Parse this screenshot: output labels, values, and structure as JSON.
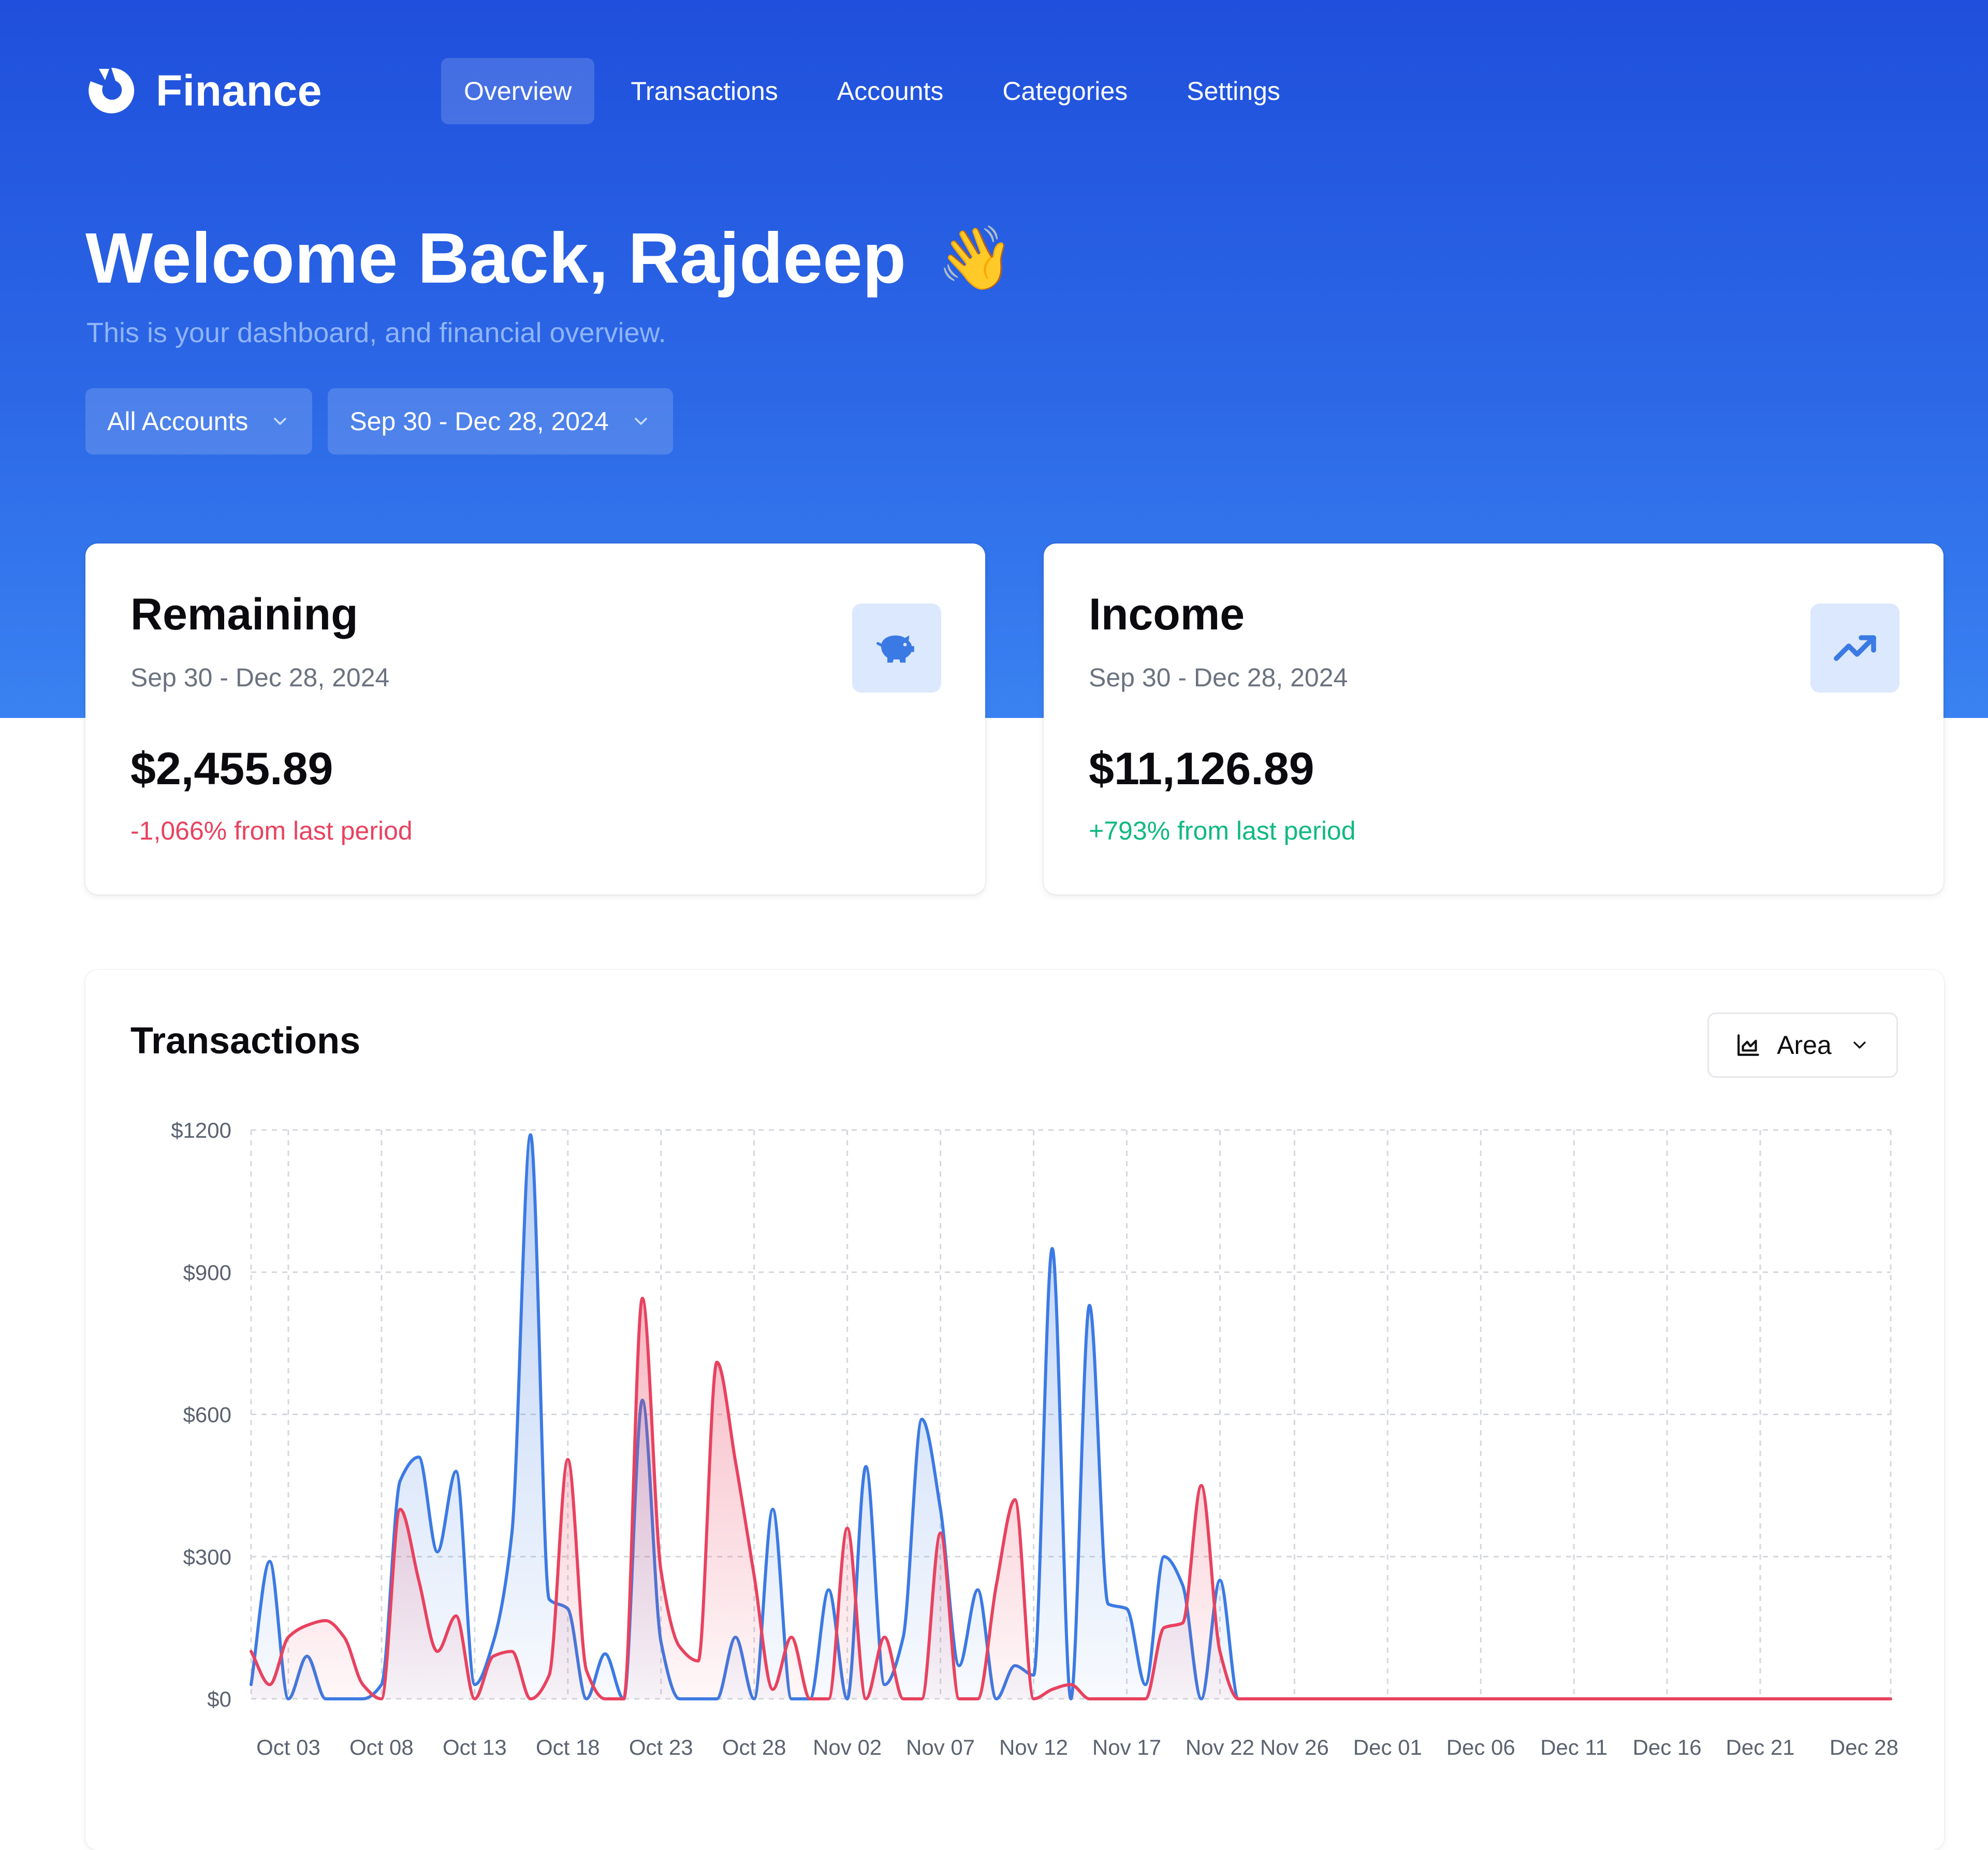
{
  "app": {
    "name": "Finance",
    "logo_icon": "finance-logo-icon"
  },
  "nav": {
    "items": [
      "Overview",
      "Transactions",
      "Accounts",
      "Categories",
      "Settings"
    ],
    "active": "Overview"
  },
  "welcome": {
    "title": "Welcome Back, Rajdeep",
    "emoji": "👋",
    "subtitle": "This is your dashboard, and financial overview."
  },
  "filters": {
    "account": "All Accounts",
    "date_range": "Sep 30 - Dec 28, 2024"
  },
  "cards": {
    "remaining": {
      "title": "Remaining",
      "period": "Sep 30 - Dec 28, 2024",
      "amount": "$2,455.89",
      "delta": "-1,066% from last period",
      "icon": "piggy-bank-icon"
    },
    "income": {
      "title": "Income",
      "period": "Sep 30 - Dec 28, 2024",
      "amount": "$11,126.89",
      "delta": "+793% from last period",
      "icon": "trending-up-icon"
    }
  },
  "colors": {
    "hero_top": "#1f4fdc",
    "hero_bottom": "#3a82f2",
    "income_series": "#3b7ae4",
    "expense_series": "#e8425f",
    "positive": "#10b981",
    "negative": "#e8425f"
  },
  "transactions": {
    "title": "Transactions",
    "chart_type_label": "Area"
  },
  "chart_data": {
    "type": "area",
    "x_range": [
      "2024-10-01",
      "2024-12-28"
    ],
    "ylim": [
      0,
      1200
    ],
    "y_ticks": [
      0,
      300,
      600,
      900,
      1200
    ],
    "y_tick_labels": [
      "$0",
      "$300",
      "$600",
      "$900",
      "$1200"
    ],
    "x_tick_labels": [
      "Oct 03",
      "Oct 08",
      "Oct 13",
      "Oct 18",
      "Oct 23",
      "Oct 28",
      "Nov 02",
      "Nov 07",
      "Nov 12",
      "Nov 17",
      "Nov 22",
      "Nov 26",
      "Dec 01",
      "Dec 06",
      "Dec 11",
      "Dec 16",
      "Dec 21",
      "Dec 28"
    ],
    "x_tick_dates": [
      "2024-10-03",
      "2024-10-08",
      "2024-10-13",
      "2024-10-18",
      "2024-10-23",
      "2024-10-28",
      "2024-11-02",
      "2024-11-07",
      "2024-11-12",
      "2024-11-17",
      "2024-11-22",
      "2024-11-26",
      "2024-12-01",
      "2024-12-06",
      "2024-12-11",
      "2024-12-16",
      "2024-12-21",
      "2024-12-28"
    ],
    "grid": true,
    "series": [
      {
        "color": "#3b7ae4",
        "points": [
          [
            "2024-10-01",
            30
          ],
          [
            "2024-10-02",
            290
          ],
          [
            "2024-10-03",
            0
          ],
          [
            "2024-10-04",
            90
          ],
          [
            "2024-10-05",
            0
          ],
          [
            "2024-10-07",
            0
          ],
          [
            "2024-10-08",
            30
          ],
          [
            "2024-10-09",
            460
          ],
          [
            "2024-10-10",
            510
          ],
          [
            "2024-10-11",
            310
          ],
          [
            "2024-10-12",
            480
          ],
          [
            "2024-10-13",
            30
          ],
          [
            "2024-10-14",
            120
          ],
          [
            "2024-10-15",
            350
          ],
          [
            "2024-10-16",
            1190
          ],
          [
            "2024-10-17",
            210
          ],
          [
            "2024-10-18",
            190
          ],
          [
            "2024-10-19",
            0
          ],
          [
            "2024-10-20",
            95
          ],
          [
            "2024-10-21",
            0
          ],
          [
            "2024-10-22",
            630
          ],
          [
            "2024-10-23",
            120
          ],
          [
            "2024-10-24",
            0
          ],
          [
            "2024-10-25",
            0
          ],
          [
            "2024-10-26",
            0
          ],
          [
            "2024-10-27",
            130
          ],
          [
            "2024-10-28",
            0
          ],
          [
            "2024-10-29",
            400
          ],
          [
            "2024-10-30",
            0
          ],
          [
            "2024-10-31",
            0
          ],
          [
            "2024-11-01",
            230
          ],
          [
            "2024-11-02",
            0
          ],
          [
            "2024-11-03",
            490
          ],
          [
            "2024-11-04",
            30
          ],
          [
            "2024-11-05",
            130
          ],
          [
            "2024-11-06",
            590
          ],
          [
            "2024-11-07",
            400
          ],
          [
            "2024-11-08",
            70
          ],
          [
            "2024-11-09",
            230
          ],
          [
            "2024-11-10",
            0
          ],
          [
            "2024-11-11",
            70
          ],
          [
            "2024-11-12",
            50
          ],
          [
            "2024-11-13",
            950
          ],
          [
            "2024-11-14",
            0
          ],
          [
            "2024-11-15",
            830
          ],
          [
            "2024-11-16",
            200
          ],
          [
            "2024-11-17",
            190
          ],
          [
            "2024-11-18",
            30
          ],
          [
            "2024-11-19",
            300
          ],
          [
            "2024-11-20",
            240
          ],
          [
            "2024-11-21",
            0
          ],
          [
            "2024-11-22",
            250
          ],
          [
            "2024-11-23",
            0
          ],
          [
            "2024-11-24",
            0
          ],
          [
            "2024-12-28",
            0
          ]
        ]
      },
      {
        "color": "#e8425f",
        "points": [
          [
            "2024-10-01",
            100
          ],
          [
            "2024-10-02",
            30
          ],
          [
            "2024-10-03",
            130
          ],
          [
            "2024-10-04",
            155
          ],
          [
            "2024-10-05",
            165
          ],
          [
            "2024-10-06",
            130
          ],
          [
            "2024-10-07",
            30
          ],
          [
            "2024-10-08",
            0
          ],
          [
            "2024-10-09",
            400
          ],
          [
            "2024-10-10",
            250
          ],
          [
            "2024-10-11",
            100
          ],
          [
            "2024-10-12",
            175
          ],
          [
            "2024-10-13",
            0
          ],
          [
            "2024-10-14",
            90
          ],
          [
            "2024-10-15",
            100
          ],
          [
            "2024-10-16",
            0
          ],
          [
            "2024-10-17",
            50
          ],
          [
            "2024-10-18",
            505
          ],
          [
            "2024-10-19",
            60
          ],
          [
            "2024-10-20",
            0
          ],
          [
            "2024-10-21",
            0
          ],
          [
            "2024-10-22",
            845
          ],
          [
            "2024-10-23",
            270
          ],
          [
            "2024-10-24",
            110
          ],
          [
            "2024-10-25",
            80
          ],
          [
            "2024-10-26",
            710
          ],
          [
            "2024-10-27",
            500
          ],
          [
            "2024-10-28",
            260
          ],
          [
            "2024-10-29",
            20
          ],
          [
            "2024-10-30",
            130
          ],
          [
            "2024-10-31",
            0
          ],
          [
            "2024-11-01",
            0
          ],
          [
            "2024-11-02",
            360
          ],
          [
            "2024-11-03",
            0
          ],
          [
            "2024-11-04",
            130
          ],
          [
            "2024-11-05",
            0
          ],
          [
            "2024-11-06",
            0
          ],
          [
            "2024-11-07",
            350
          ],
          [
            "2024-11-08",
            0
          ],
          [
            "2024-11-09",
            0
          ],
          [
            "2024-11-10",
            240
          ],
          [
            "2024-11-11",
            420
          ],
          [
            "2024-11-12",
            0
          ],
          [
            "2024-11-13",
            20
          ],
          [
            "2024-11-14",
            30
          ],
          [
            "2024-11-15",
            0
          ],
          [
            "2024-11-16",
            0
          ],
          [
            "2024-11-17",
            0
          ],
          [
            "2024-11-18",
            0
          ],
          [
            "2024-11-19",
            150
          ],
          [
            "2024-11-20",
            160
          ],
          [
            "2024-11-21",
            450
          ],
          [
            "2024-11-22",
            100
          ],
          [
            "2024-11-23",
            0
          ],
          [
            "2024-12-28",
            0
          ]
        ]
      }
    ]
  }
}
